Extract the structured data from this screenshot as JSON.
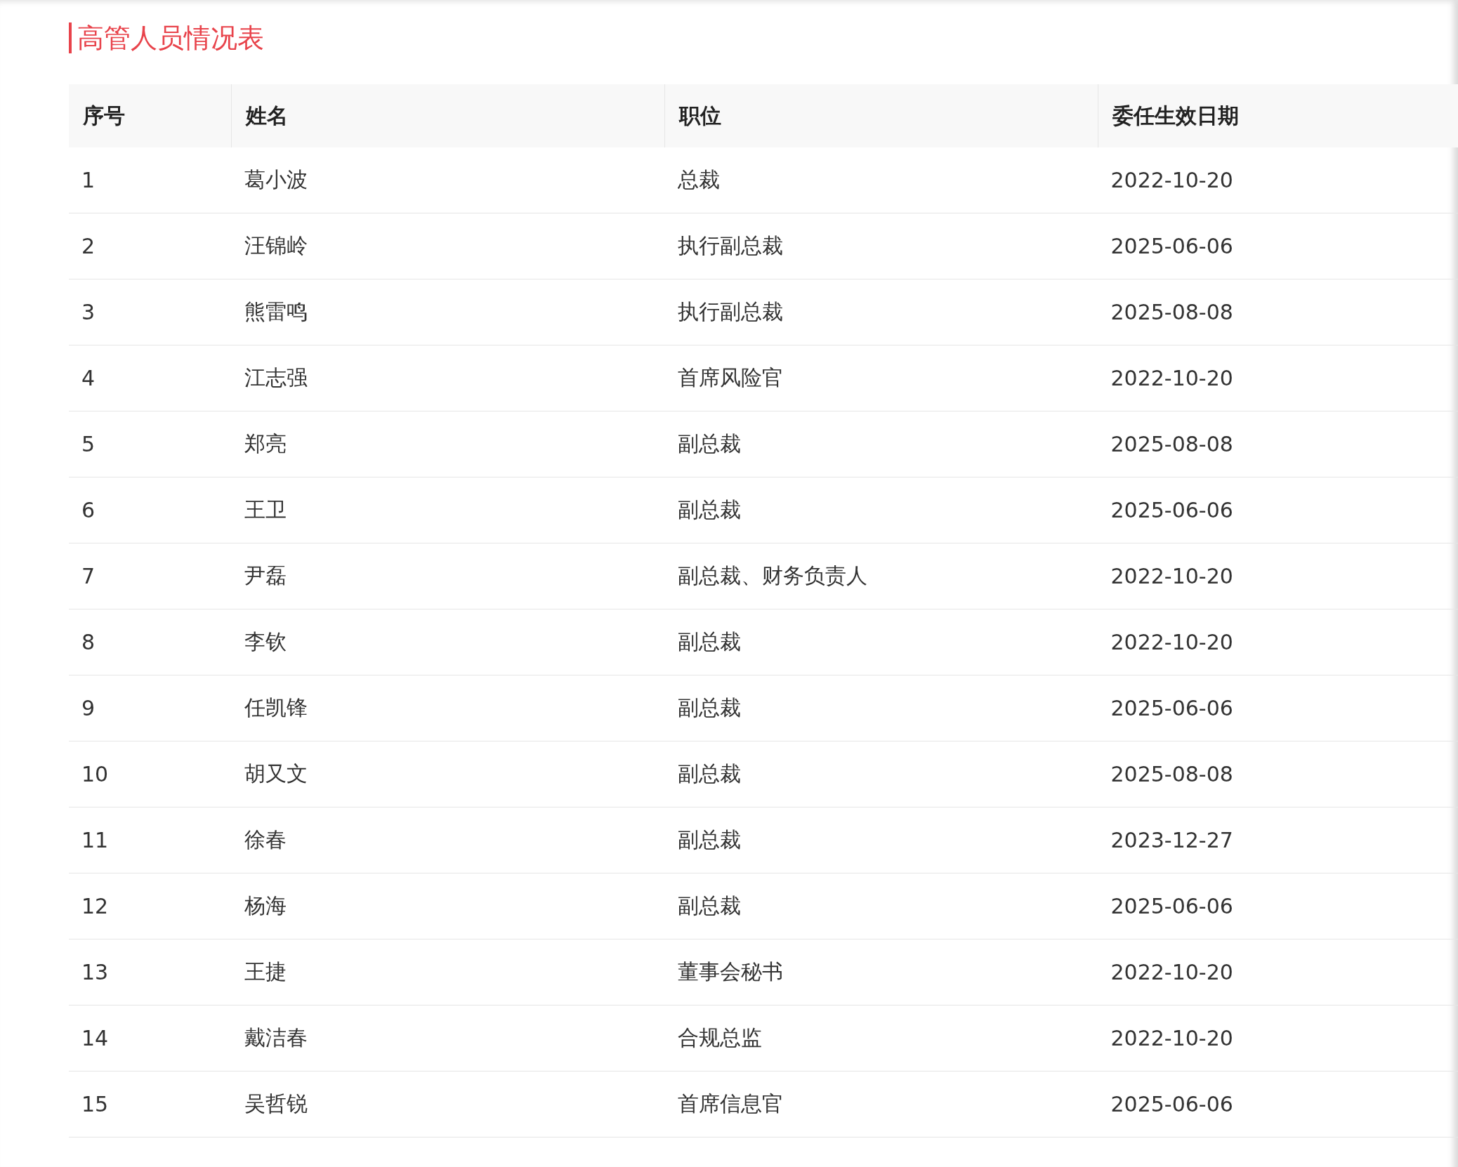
{
  "title": "高管人员情况表",
  "table": {
    "columns": [
      "序号",
      "姓名",
      "职位",
      "委任生效日期"
    ],
    "rows": [
      [
        "1",
        "葛小波",
        "总裁",
        "2022-10-20"
      ],
      [
        "2",
        "汪锦岭",
        "执行副总裁",
        "2025-06-06"
      ],
      [
        "3",
        "熊雷鸣",
        "执行副总裁",
        "2025-08-08"
      ],
      [
        "4",
        "江志强",
        "首席风险官",
        "2022-10-20"
      ],
      [
        "5",
        "郑亮",
        "副总裁",
        "2025-08-08"
      ],
      [
        "6",
        "王卫",
        "副总裁",
        "2025-06-06"
      ],
      [
        "7",
        "尹磊",
        "副总裁、财务负责人",
        "2022-10-20"
      ],
      [
        "8",
        "李钦",
        "副总裁",
        "2022-10-20"
      ],
      [
        "9",
        "任凯锋",
        "副总裁",
        "2025-06-06"
      ],
      [
        "10",
        "胡又文",
        "副总裁",
        "2025-08-08"
      ],
      [
        "11",
        "徐春",
        "副总裁",
        "2023-12-27"
      ],
      [
        "12",
        "杨海",
        "副总裁",
        "2025-06-06"
      ],
      [
        "13",
        "王捷",
        "董事会秘书",
        "2022-10-20"
      ],
      [
        "14",
        "戴洁春",
        "合规总监",
        "2022-10-20"
      ],
      [
        "15",
        "吴哲锐",
        "首席信息官",
        "2025-06-06"
      ]
    ]
  }
}
